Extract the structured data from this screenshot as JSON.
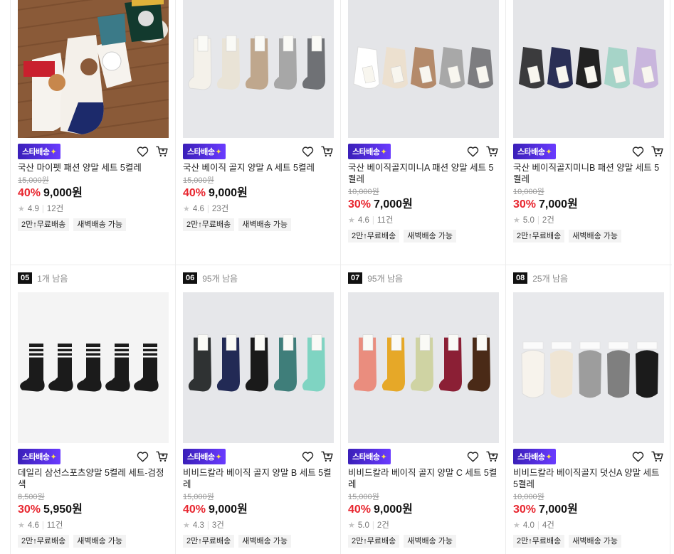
{
  "products": [
    {
      "rank": "",
      "stock": "",
      "name": "국산 마이펫 패션 양말 세트 5켤레",
      "original_price": "15,000원",
      "discount": "40%",
      "price": "9,000원",
      "rating": "4.9",
      "reviews": "12건",
      "badge": "스타배송",
      "tags": [
        "2만↑무료배송",
        "새벽배송 가능"
      ],
      "image": "pet-character-socks-photo"
    },
    {
      "rank": "",
      "stock": "",
      "name": "국산 베이직 골지 양말 A 세트 5켤레",
      "original_price": "15,000원",
      "discount": "40%",
      "price": "9,000원",
      "rating": "4.6",
      "reviews": "23건",
      "badge": "스타배송",
      "tags": [
        "2만↑무료배송",
        "새벽배송 가능"
      ],
      "image": "basic-crew-socks-a"
    },
    {
      "rank": "",
      "stock": "",
      "name": "국산 베이직골지미니A 패션 양말 세트 5켤레",
      "original_price": "10,000원",
      "discount": "30%",
      "price": "7,000원",
      "rating": "4.6",
      "reviews": "11건",
      "badge": "스타배송",
      "tags": [
        "2만↑무료배송",
        "새벽배송 가능"
      ],
      "image": "mini-ankle-socks-a"
    },
    {
      "rank": "",
      "stock": "",
      "name": "국산 베이직골지미니B 패션 양말 세트 5켤레",
      "original_price": "10,000원",
      "discount": "30%",
      "price": "7,000원",
      "rating": "5.0",
      "reviews": "2건",
      "badge": "스타배송",
      "tags": [
        "2만↑무료배송",
        "새벽배송 가능"
      ],
      "image": "mini-ankle-socks-b"
    },
    {
      "rank": "05",
      "stock": "1개 남음",
      "name": "데일리 삼선스포츠양말 5켤레 세트-검정색",
      "original_price": "8,500원",
      "discount": "30%",
      "price": "5,950원",
      "rating": "4.6",
      "reviews": "11건",
      "badge": "스타배송",
      "tags": [
        "2만↑무료배송",
        "새벽배송 가능"
      ],
      "image": "three-stripe-black-sport-socks"
    },
    {
      "rank": "06",
      "stock": "95개 남음",
      "name": "비비드칼라 베이직 골지 양말 B 세트 5켤레",
      "original_price": "15,000원",
      "discount": "40%",
      "price": "9,000원",
      "rating": "4.3",
      "reviews": "3건",
      "badge": "스타배송",
      "tags": [
        "2만↑무료배송",
        "새벽배송 가능"
      ],
      "image": "vivid-crew-socks-b"
    },
    {
      "rank": "07",
      "stock": "95개 남음",
      "name": "비비드칼라 베이직 골지 양말 C 세트 5켤레",
      "original_price": "15,000원",
      "discount": "40%",
      "price": "9,000원",
      "rating": "5.0",
      "reviews": "2건",
      "badge": "스타배송",
      "tags": [
        "2만↑무료배송",
        "새벽배송 가능"
      ],
      "image": "vivid-crew-socks-c"
    },
    {
      "rank": "08",
      "stock": "25개 남음",
      "name": "비비드칼라 베이직골지 덧신A 양말 세트 5켤레",
      "original_price": "10,000원",
      "discount": "30%",
      "price": "7,000원",
      "rating": "4.0",
      "reviews": "4건",
      "badge": "스타배송",
      "tags": [
        "2만↑무료배송",
        "새벽배송 가능"
      ],
      "image": "no-show-socks-a"
    }
  ],
  "colors": {
    "discount": "#e8262f",
    "badge_start": "#3a1fb8",
    "badge_end": "#6a3bff",
    "tag_bg": "#f3f3f3",
    "rank_bg": "#111111"
  },
  "icons": [
    "heart-icon",
    "cart-icon",
    "star-icon"
  ]
}
